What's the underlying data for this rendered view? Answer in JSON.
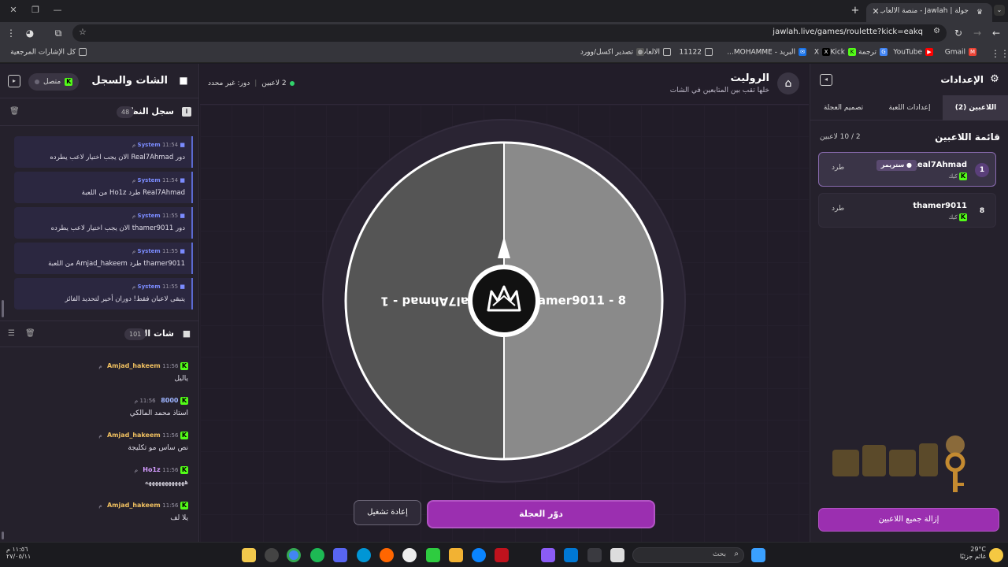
{
  "browser": {
    "tab_title": "جولة | Jawlah - منصة الألعاب الت...",
    "url": "jawlah.live/games/roulette?kick=eakq",
    "bookmarks": [
      {
        "label": "Gmail",
        "color": "#ea4335"
      },
      {
        "label": "YouTube",
        "color": "#ff0000"
      },
      {
        "label": "ترجمة",
        "color": "#4285f4"
      },
      {
        "label": "Kick",
        "color": "#53fc18"
      },
      {
        "label": "X",
        "color": "#000000"
      },
      {
        "label": "البريد - MOHAMME...",
        "color": "#1a73e8"
      },
      {
        "label": "11122",
        "color": "#777777"
      },
      {
        "label": "الالعاب",
        "color": "#777777"
      },
      {
        "label": "تصدير اكسل/وورد",
        "color": "#777777"
      },
      {
        "label": "كل الإشارات المرجعية",
        "color": "#777777"
      }
    ]
  },
  "left": {
    "title": "الشات والسجل",
    "connection": "متصل",
    "system_log": {
      "title": "سجل النظام",
      "count": "48",
      "messages": [
        {
          "sender": "System",
          "time": "11:54 م",
          "text": "دور Real7Ahmad الان يجب اختيار لاعب يطرده"
        },
        {
          "sender": "System",
          "time": "11:54 م",
          "text": "Real7Ahmad طرد Ho1z من اللعبة"
        },
        {
          "sender": "System",
          "time": "11:55 م",
          "text": "دور thamer9011 الان يجب اختيار لاعب يطرده"
        },
        {
          "sender": "System",
          "time": "11:55 م",
          "text": "thamer9011 طرد Amjad_hakeem من اللعبة"
        },
        {
          "sender": "System",
          "time": "11:55 م",
          "text": "يتبقى لاعبان فقط! دوران أخير لتحديد الفائز"
        }
      ]
    },
    "stream_chat": {
      "title": "شات البث",
      "count": "101",
      "messages": [
        {
          "user": "Amjad_hakeem",
          "time": "11:56 م",
          "text": "ياليل",
          "color": "#f0c060"
        },
        {
          "user": "8000",
          "time": "11:56 م",
          "text": "استاذ محمد المالكي",
          "color": "#9db4ff"
        },
        {
          "user": "Amjad_hakeem",
          "time": "11:56 م",
          "text": "نص ساس مو تكليجة",
          "color": "#f0c060"
        },
        {
          "user": "Ho1z",
          "time": "11:56 م",
          "text": "ههههههههههههه",
          "color": "#d49cff"
        },
        {
          "user": "Amjad_hakeem",
          "time": "11:56 م",
          "text": "يلا لف",
          "color": "#f0c060"
        }
      ]
    }
  },
  "center": {
    "title": "الروليت",
    "subtitle": "خلها تقب بين المتابعين في الشات",
    "players_count": "2 لاعبين",
    "turn_status": "دور: غير محدد",
    "wheel": {
      "segments": [
        {
          "label": "8 - thamer9011",
          "color": "#8a8a8a"
        },
        {
          "label": "1 - Real7Ahmad",
          "color": "#555555"
        }
      ]
    },
    "spin_label": "دوّر العجلة",
    "replay_label": "إعادة تشغيل"
  },
  "right": {
    "title": "الإعدادات",
    "tabs": [
      "اللاعبين (2)",
      "إعدادات اللعبة",
      "تصميم العجلة"
    ],
    "player_list_title": "قائمة اللاعبين",
    "player_count": "2 / 10 لاعبين",
    "players": [
      {
        "rank": "1",
        "name": "Real7Ahmad",
        "platform": "كيك",
        "badge": "ستريمر",
        "kick_label": "طرد"
      },
      {
        "rank": "8",
        "name": "thamer9011",
        "platform": "كيك",
        "badge": "",
        "kick_label": "طرد"
      }
    ],
    "remove_all_label": "إزالة جميع اللاعبين"
  },
  "taskbar": {
    "search_placeholder": "بحث",
    "weather_temp": "29°C",
    "weather_desc": "غائم جزئيًا",
    "clock_time": "١١:٥٦ م",
    "clock_date": "٢٧/٠٥/١١"
  },
  "colors": {
    "accent": "#9b2fb0",
    "kick_green": "#53fc18",
    "system_blue": "#7b8cff"
  }
}
